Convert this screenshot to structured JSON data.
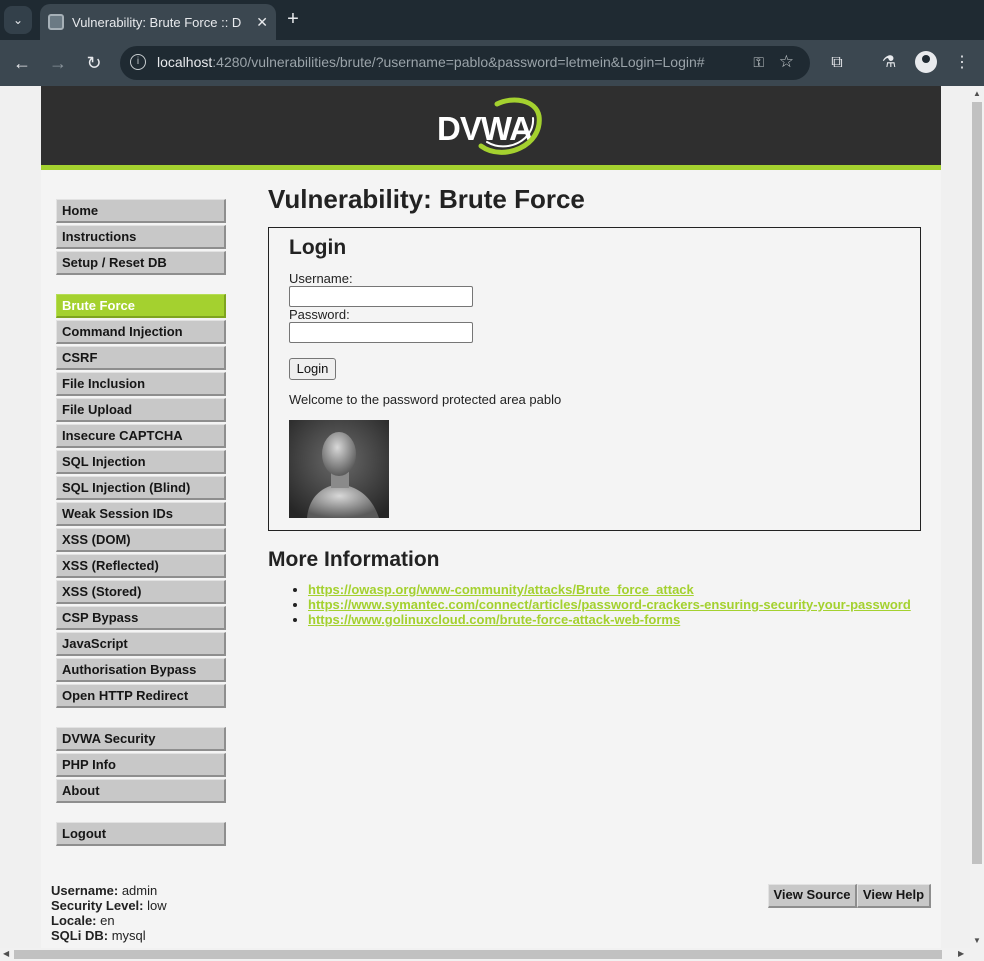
{
  "browser": {
    "tab_title": "Vulnerability: Brute Force :: D",
    "url_host": "localhost",
    "url_rest": ":4280/vulnerabilities/brute/?username=pablo&password=letmein&Login=Login#"
  },
  "header": {
    "logo_text": "DVWA"
  },
  "sidebar": {
    "group1": [
      "Home",
      "Instructions",
      "Setup / Reset DB"
    ],
    "group2": [
      "Brute Force",
      "Command Injection",
      "CSRF",
      "File Inclusion",
      "File Upload",
      "Insecure CAPTCHA",
      "SQL Injection",
      "SQL Injection (Blind)",
      "Weak Session IDs",
      "XSS (DOM)",
      "XSS (Reflected)",
      "XSS (Stored)",
      "CSP Bypass",
      "JavaScript",
      "Authorisation Bypass",
      "Open HTTP Redirect"
    ],
    "group3": [
      "DVWA Security",
      "PHP Info",
      "About"
    ],
    "group4": [
      "Logout"
    ],
    "active": "Brute Force"
  },
  "main": {
    "title": "Vulnerability: Brute Force",
    "login": {
      "heading": "Login",
      "username_label": "Username:",
      "password_label": "Password:",
      "button_label": "Login",
      "welcome": "Welcome to the password protected area pablo"
    },
    "more_info": {
      "heading": "More Information",
      "links": [
        "https://owasp.org/www-community/attacks/Brute_force_attack",
        "https://www.symantec.com/connect/articles/password-crackers-ensuring-security-your-password",
        "https://www.golinuxcloud.com/brute-force-attack-web-forms"
      ]
    }
  },
  "footer": {
    "username_label": "Username:",
    "username_value": "admin",
    "security_label": "Security Level:",
    "security_value": "low",
    "locale_label": "Locale:",
    "locale_value": "en",
    "sqli_label": "SQLi DB:",
    "sqli_value": "mysql",
    "view_source": "View Source",
    "view_help": "View Help"
  },
  "colors": {
    "accent_green": "#a4d12f",
    "header_bg": "#2f2f2f",
    "chrome_dark": "#1f2a32",
    "chrome_toolbar": "#3b4750"
  }
}
